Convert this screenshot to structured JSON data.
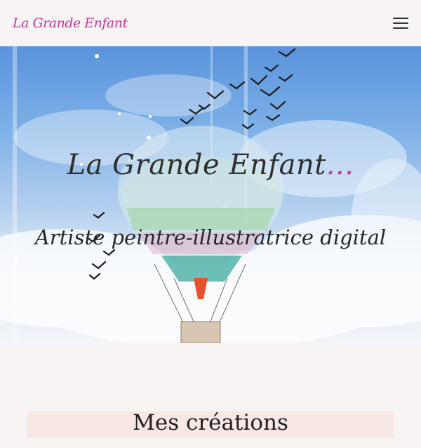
{
  "header": {
    "logo_text": "La Grande Enfant",
    "menu_icon": "hamburger-menu-icon"
  },
  "hero": {
    "title_main": "La Grande Enfant",
    "title_dots": "...",
    "subtitle": "Artiste peintre-illustratrice digital"
  },
  "sections": {
    "creations_title": "Mes créations"
  },
  "colors": {
    "brand_pink": "#c8339a",
    "background": "#f8f4f4",
    "section_band": "#f7e8e4"
  }
}
